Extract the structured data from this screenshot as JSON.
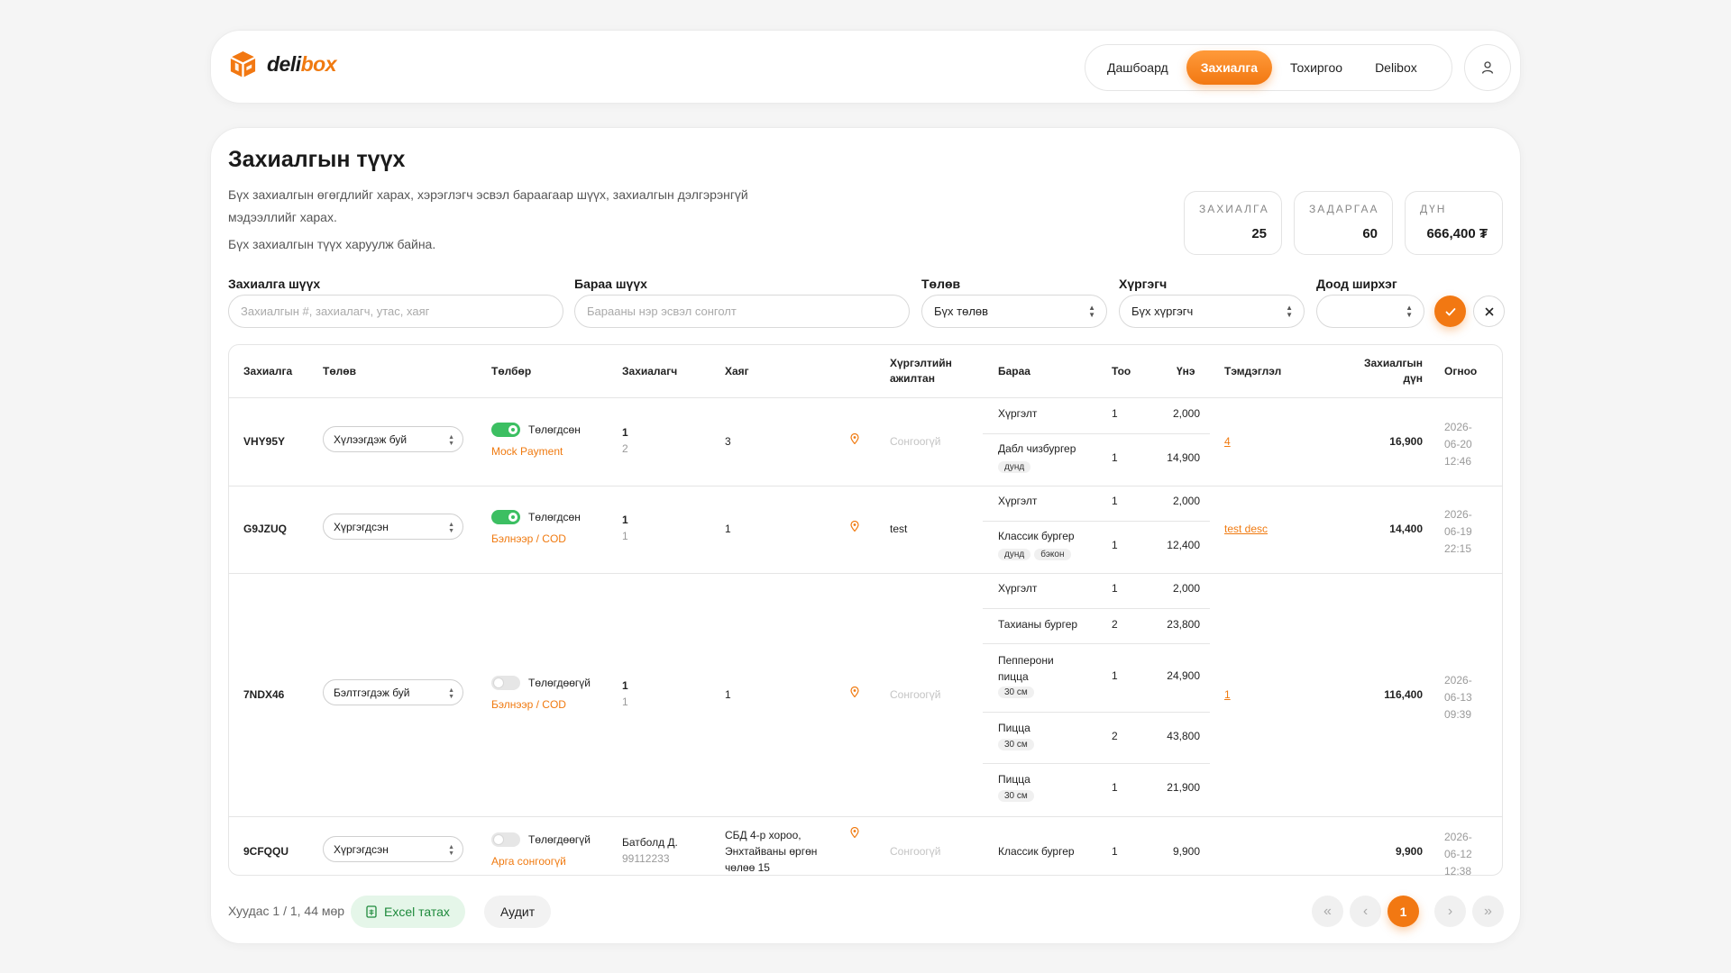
{
  "brand": {
    "name_part1": "deli",
    "name_part2": "box",
    "accent": "#f27812"
  },
  "nav": {
    "items": [
      "Дашбоард",
      "Захиалга",
      "Тохиргоо",
      "Delibox"
    ],
    "active": "Захиалга"
  },
  "page": {
    "title": "Захиалгын түүх",
    "description": "Бүх захиалгын өгөгдлийг харах, хэрэглэгч эсвэл бараагаар шүүх, захиалгын дэлгэрэнгүй мэдээллийг харах.",
    "subdescription": "Бүх захиалгын түүх харуулж байна."
  },
  "stats": [
    {
      "label": "ЗАХИАЛГА",
      "value": "25"
    },
    {
      "label": "ЗАДАРГАА",
      "value": "60"
    },
    {
      "label": "ДҮН",
      "value": "666,400 ₮"
    }
  ],
  "filters": {
    "order_search": {
      "label": "Захиалга шүүх",
      "placeholder": "Захиалгын #, захиалагч, утас, хаяг"
    },
    "product_search": {
      "label": "Бараа шүүх",
      "placeholder": "Барааны нэр эсвэл сонголт"
    },
    "status": {
      "label": "Төлөв",
      "value": "Бүх төлөв"
    },
    "courier": {
      "label": "Хүргэгч",
      "value": "Бүх хүргэгч"
    },
    "min_count": {
      "label": "Доод ширхэг",
      "value": ""
    }
  },
  "table": {
    "headers": [
      "Захиалга",
      "Төлөв",
      "Төлбөр",
      "Захиалагч",
      "Хаяг",
      "Хүргэлтийн ажилтан",
      "Бараа",
      "Тоо",
      "Үнэ",
      "Тэмдэглэл",
      "Захиалгын дүн",
      "Огноо"
    ],
    "rows": [
      {
        "id": "VHY95Y",
        "status": "Хүлээгдэж буй",
        "paid": true,
        "paid_label": "Төлөгдсөн",
        "payment_method": "Mock Payment",
        "customer": "1",
        "phone": "2",
        "address": "3",
        "courier": "Сонгоогүй",
        "note": "4",
        "total": "16,900",
        "date": [
          "2026-",
          "06-20",
          "12:46"
        ],
        "items": [
          {
            "name": "Хүргэлт",
            "tags": [],
            "qty": "1",
            "price": "2,000"
          },
          {
            "name": "Дабл чизбургер",
            "tags": [
              "дунд"
            ],
            "qty": "1",
            "price": "14,900"
          }
        ]
      },
      {
        "id": "G9JZUQ",
        "status": "Хүргэгдсэн",
        "paid": true,
        "paid_label": "Төлөгдсөн",
        "payment_method": "Бэлнээр / COD",
        "customer": "1",
        "phone": "1",
        "address": "1",
        "courier": "test",
        "note": "test desc",
        "total": "14,400",
        "date": [
          "2026-",
          "06-19",
          "22:15"
        ],
        "items": [
          {
            "name": "Хүргэлт",
            "tags": [],
            "qty": "1",
            "price": "2,000"
          },
          {
            "name": "Классик бургер",
            "tags": [
              "дунд",
              "бэкон"
            ],
            "qty": "1",
            "price": "12,400"
          }
        ]
      },
      {
        "id": "7NDX46",
        "status": "Бэлтгэгдэж буй",
        "paid": false,
        "paid_label": "Төлөгдөөгүй",
        "payment_method": "Бэлнээр / COD",
        "customer": "1",
        "phone": "1",
        "address": "1",
        "courier": "Сонгоогүй",
        "note": "1",
        "total": "116,400",
        "date": [
          "2026-",
          "06-13",
          "09:39"
        ],
        "items": [
          {
            "name": "Хүргэлт",
            "tags": [],
            "qty": "1",
            "price": "2,000"
          },
          {
            "name": "Тахианы бургер",
            "tags": [],
            "qty": "2",
            "price": "23,800"
          },
          {
            "name": "Пепперони пицца",
            "tags": [
              "30 см"
            ],
            "qty": "1",
            "price": "24,900"
          },
          {
            "name": "Пицца",
            "tags": [
              "30 см"
            ],
            "qty": "2",
            "price": "43,800"
          },
          {
            "name": "Пицца",
            "tags": [
              "30 см"
            ],
            "qty": "1",
            "price": "21,900"
          }
        ]
      },
      {
        "id": "9CFQQU",
        "status": "Хүргэгдсэн",
        "paid": false,
        "paid_label": "Төлөгдөөгүй",
        "payment_method": "Арга сонгоогүй",
        "customer": "Батболд Д.",
        "phone": "99112233",
        "address": "СБД 4-р хороо, Энхтайваны өргөн чөлөө 15",
        "courier": "Сонгоогүй",
        "note": "",
        "total": "9,900",
        "date": [
          "2026-",
          "06-12",
          "12:38"
        ],
        "items": [
          {
            "name": "Классик бургер",
            "tags": [],
            "qty": "1",
            "price": "9,900"
          }
        ]
      }
    ]
  },
  "footer": {
    "page_info": "Хуудас 1 / 1, 44 мөр",
    "excel_label": "Excel татах",
    "audit_label": "Аудит",
    "current_page": "1"
  }
}
